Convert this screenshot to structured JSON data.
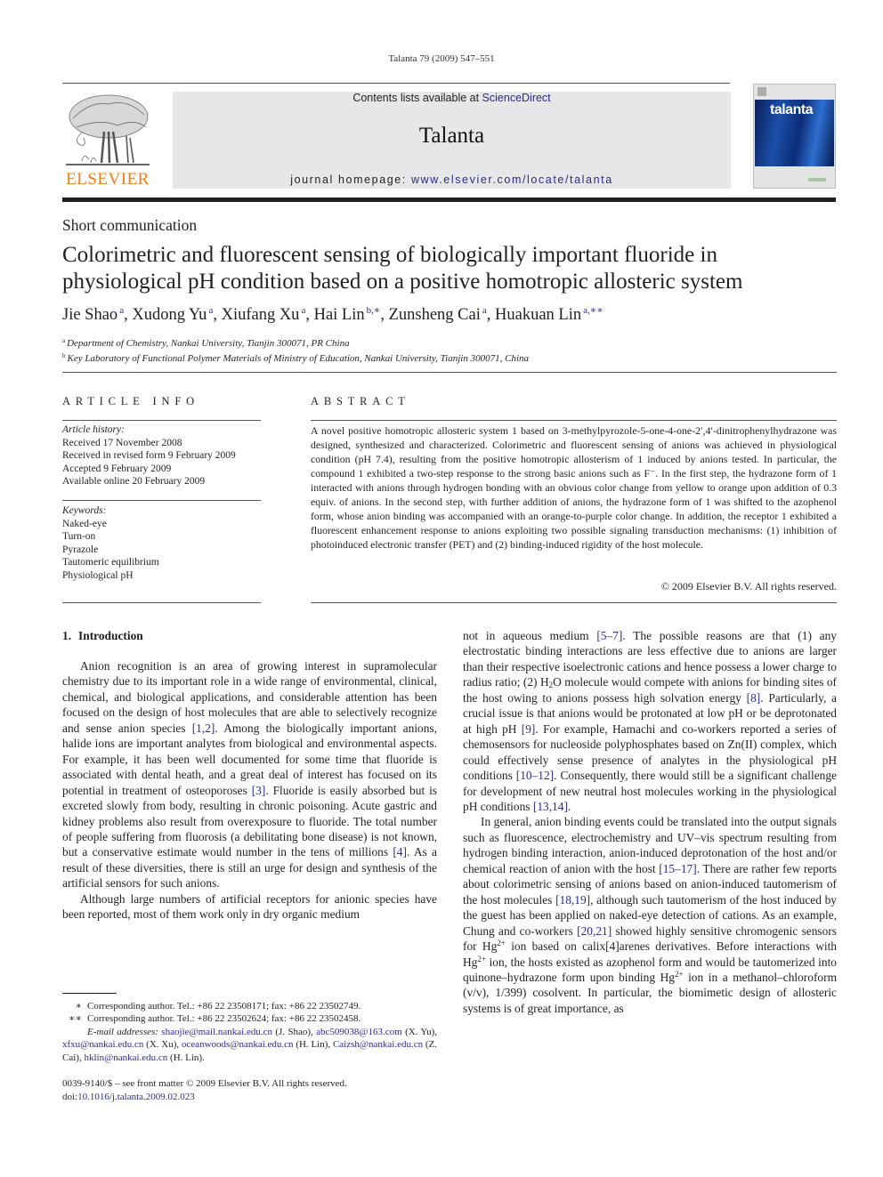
{
  "running_head": "Talanta 79 (2009) 547–551",
  "masthead": {
    "publisher_logo_text": "ELSEVIER",
    "contents_prefix": "Contents lists available at ",
    "contents_link": "ScienceDirect",
    "journal_name": "Talanta",
    "homepage_prefix": "journal homepage: ",
    "homepage_link": "www.elsevier.com/locate/talanta",
    "cover_title": "talanta",
    "colors": {
      "elsevier_orange": "#e97e18",
      "link_blue": "#2b2b8f",
      "mast_grey": "#e6e7e9"
    }
  },
  "article": {
    "type": "Short communication",
    "title": "Colorimetric and fluorescent sensing of biologically important fluoride in physiological pH condition based on a positive homotropic allosteric system",
    "authors": [
      {
        "name": "Jie Shao",
        "sup": "a",
        "sep": ", "
      },
      {
        "name": "Xudong Yu",
        "sup": "a",
        "sep": ", "
      },
      {
        "name": "Xiufang Xu",
        "sup": "a",
        "sep": ", "
      },
      {
        "name": "Hai Lin",
        "sup": "b,∗",
        "sep": ", "
      },
      {
        "name": "Zunsheng Cai",
        "sup": "a",
        "sep": ", "
      },
      {
        "name": "Huakuan Lin",
        "sup": "a,∗∗",
        "sep": ""
      }
    ],
    "affiliations": [
      {
        "mark": "a",
        "text": "Department of Chemistry, Nankai University, Tianjin 300071, PR China"
      },
      {
        "mark": "b",
        "text": "Key Laboratory of Functional Polymer Materials of Ministry of Education, Nankai University, Tianjin 300071, China"
      }
    ]
  },
  "article_info": {
    "heading": "ARTICLE INFO",
    "history_label": "Article history:",
    "history": [
      "Received 17 November 2008",
      "Received in revised form 9 February 2009",
      "Accepted 9 February 2009",
      "Available online 20 February 2009"
    ],
    "keywords_label": "Keywords:",
    "keywords": [
      "Naked-eye",
      "Turn-on",
      "Pyrazole",
      "Tautomeric equilibrium",
      "Physiological pH"
    ]
  },
  "abstract": {
    "heading": "ABSTRACT",
    "text": "A novel positive homotropic allosteric system 1 based on 3-methylpyrozole-5-one-4-one-2′,4′-dinitrophenylhydrazone was designed, synthesized and characterized. Colorimetric and fluorescent sensing of anions was achieved in physiological condition (pH 7.4), resulting from the positive homotropic allosterism of 1 induced by anions tested. In particular, the compound 1 exhibited a two-step response to the strong basic anions such as F⁻. In the first step, the hydrazone form of 1 interacted with anions through hydrogen bonding with an obvious color change from yellow to orange upon addition of 0.3 equiv. of anions. In the second step, with further addition of anions, the hydrazone form of 1 was shifted to the azophenol form, whose anion binding was accompanied with an orange-to-purple color change. In addition, the receptor 1 exhibited a fluorescent enhancement response to anions exploiting two possible signaling transduction mechanisms: (1) inhibition of photoinduced electronic transfer (PET) and (2) binding-induced rigidity of the host molecule.",
    "copyright": "© 2009 Elsevier B.V. All rights reserved."
  },
  "body": {
    "section": {
      "number": "1.",
      "title": "Introduction"
    },
    "left_paragraphs": [
      [
        {
          "t": "Anion recognition is an area of growing interest in supramolecular chemistry due to its important role in a wide range of environmental, clinical, chemical, and biological applications, and considerable attention has been focused on the design of host molecules that are able to selectively recognize and sense anion species "
        },
        {
          "ref": "[1,2]"
        },
        {
          "t": ". Among the biologically important anions, halide ions are important analytes from biological and environmental aspects. For example, it has been well documented for some time that fluoride is associated with dental heath, and a great deal of interest has focused on its potential in treatment of osteoporoses "
        },
        {
          "ref": "[3]"
        },
        {
          "t": ". Fluoride is easily absorbed but is excreted slowly from body, resulting in chronic poisoning. Acute gastric and kidney problems also result from overexposure to fluoride. The total number of people suffering from fluorosis (a debilitating bone disease) is not known, but a conservative estimate would number in the tens of millions "
        },
        {
          "ref": "[4]"
        },
        {
          "t": ". As a result of these diversities, there is still an urge for design and synthesis of the artificial sensors for such anions."
        }
      ],
      [
        {
          "t": "Although large numbers of artificial receptors for anionic species have been reported, most of them work only in dry organic medium"
        }
      ]
    ],
    "right_paragraphs": [
      [
        {
          "t": "not in aqueous medium "
        },
        {
          "ref": "[5–7]"
        },
        {
          "t": ". The possible reasons are that (1) any electrostatic binding interactions are less effective due to anions are larger than their respective isoelectronic cations and hence possess a lower charge to radius ratio; (2) H"
        },
        {
          "sub": "2"
        },
        {
          "t": "O molecule would compete with anions for binding sites of the host owing to anions possess high solvation energy "
        },
        {
          "ref": "[8]"
        },
        {
          "t": ". Particularly, a crucial issue is that anions would be protonated at low pH or be deprotonated at high pH "
        },
        {
          "ref": "[9]"
        },
        {
          "t": ". For example, Hamachi and co-workers reported a series of chemosensors for nucleoside polyphosphates based on Zn(II) complex, which could effectively sense presence of analytes in the physiological pH conditions "
        },
        {
          "ref": "[10–12]"
        },
        {
          "t": ". Consequently, there would still be a significant challenge for development of new neutral host molecules working in the physiological pH conditions "
        },
        {
          "ref": "[13,14]"
        },
        {
          "t": "."
        }
      ],
      [
        {
          "t": "In general, anion binding events could be translated into the output signals such as fluorescence, electrochemistry and UV–vis spectrum resulting from hydrogen binding interaction, anion-induced deprotonation of the host and/or chemical reaction of anion with the host "
        },
        {
          "ref": "[15–17]"
        },
        {
          "t": ". There are rather few reports about colorimetric sensing of anions based on anion-induced tautomerism of the host molecules "
        },
        {
          "ref": "[18,19]"
        },
        {
          "t": ", although such tautomerism of the host induced by the guest has been applied on naked-eye detection of cations. As an example, Chung and co-workers "
        },
        {
          "ref": "[20,21]"
        },
        {
          "t": " showed highly sensitive chromogenic sensors for Hg"
        },
        {
          "sup": "2+"
        },
        {
          "t": " ion based on calix[4]arenes derivatives. Before interactions with Hg"
        },
        {
          "sup": "2+"
        },
        {
          "t": " ion, the hosts existed as azophenol form and would be tautomerized into quinone–hydrazone form upon binding Hg"
        },
        {
          "sup": "2+"
        },
        {
          "t": " ion in a methanol–chloroform (v/v), 1/399) cosolvent. In particular, the biomimetic design of allosteric systems is of great importance, as"
        }
      ]
    ]
  },
  "footnotes": {
    "corresponding": [
      {
        "mark": "∗",
        "text": "Corresponding author. Tel.: +86 22 23508171; fax: +86 22 23502749."
      },
      {
        "mark": "∗∗",
        "text": "Corresponding author. Tel.: +86 22 23502624; fax: +86 22 23502458."
      }
    ],
    "email_label": "E-mail addresses:",
    "emails": [
      {
        "email": "shaojie@mail.nankai.edu.cn",
        "owner": " (J. Shao), "
      },
      {
        "email": "abc509038@163.com",
        "owner": " (X. Yu), "
      },
      {
        "email": "xfxu@nankai.edu.cn",
        "owner": " (X. Xu), "
      },
      {
        "email": "oceanwoods@nankai.edu.cn",
        "owner": " (H. Lin), "
      },
      {
        "email": "Caizsh@nankai.edu.cn",
        "owner": " (Z. Cai), "
      },
      {
        "email": "hklin@nankai.edu.cn",
        "owner": " (H. Lin)."
      }
    ]
  },
  "front_matter": {
    "issn_line": "0039-9140/$ – see front matter © 2009 Elsevier B.V. All rights reserved.",
    "doi_prefix": "doi:",
    "doi": "10.1016/j.talanta.2009.02.023"
  }
}
